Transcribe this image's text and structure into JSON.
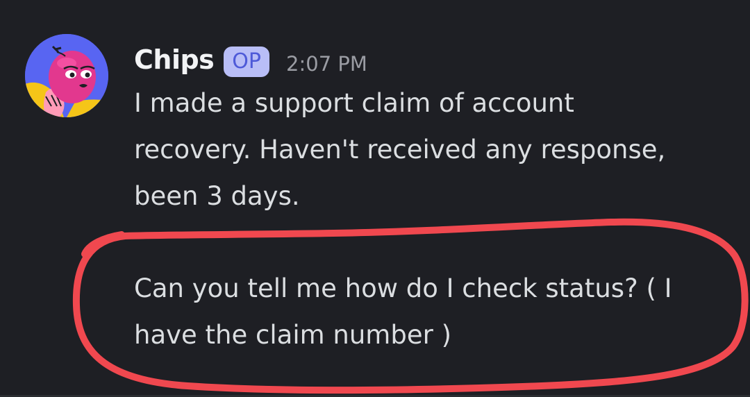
{
  "message": {
    "author": "Chips",
    "badge": "OP",
    "timestamp": "2:07 PM",
    "paragraph1_lines": [
      "I made a support claim of account",
      "recovery. Haven't received any response,",
      "been 3 days."
    ],
    "paragraph2_lines": [
      "Can you tell me how do I check status? ( I",
      "have the claim number )"
    ]
  },
  "colors": {
    "background": "#1e1f24",
    "text": "#dbdee1",
    "username": "#f2f3f5",
    "timestamp": "#9a9ca3",
    "badge_bg": "#b9bef7",
    "badge_text": "#4e5ad8",
    "avatar_bg": "#5865f2",
    "annotation": "#f0484f"
  },
  "icons": {
    "avatar": "pink-character-avatar",
    "annotation": "red-hand-drawn-circle"
  }
}
